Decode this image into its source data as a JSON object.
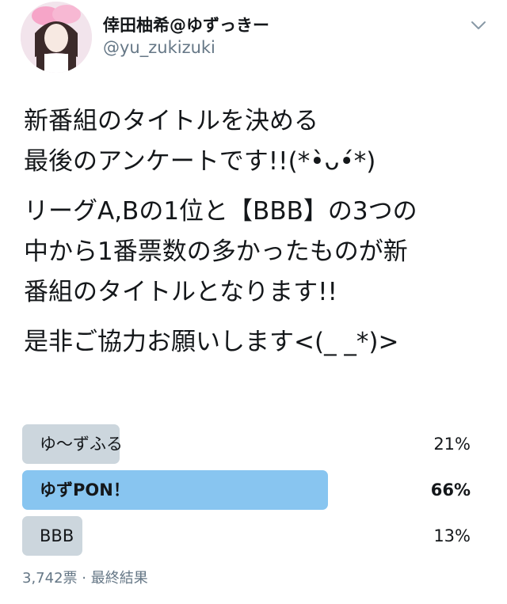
{
  "user": {
    "display_name": "倖田柚希@ゆずっきー",
    "handle": "@yu_zukizuki"
  },
  "tweet": {
    "lines": [
      "新番組のタイトルを決める",
      "最後のアンケートです!!(*•̀ᴗ•́*)",
      "リーグA,Bの1位と【BBB】の3つの",
      "中から1番票数の多かったものが新",
      "番組のタイトルとなります!!",
      "是非ご協力お願いします<(_ _*)>"
    ]
  },
  "poll": {
    "options": [
      {
        "label": "ゆ〜ずふる",
        "percent_label": "21%",
        "percent": 21,
        "winner": false
      },
      {
        "label": "ゆずPON！",
        "percent_label": "66%",
        "percent": 66,
        "winner": true
      },
      {
        "label": "BBB",
        "percent_label": "13%",
        "percent": 13,
        "winner": false
      }
    ],
    "votes": "3,742票",
    "separator": "·",
    "status": "最終結果"
  },
  "colors": {
    "bar": "#ccd6dd",
    "winner_bar": "#88c5f0",
    "text": "#14171a",
    "muted": "#657786"
  }
}
